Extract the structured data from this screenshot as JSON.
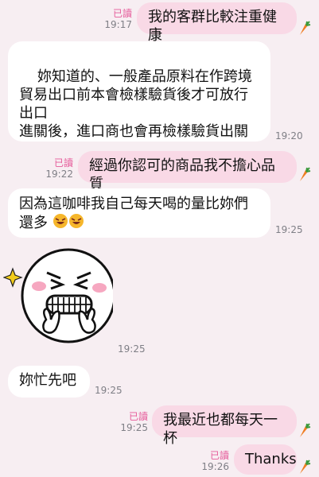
{
  "messages": {
    "m1": {
      "text": "我的客群比較注重健康",
      "read": "已讀",
      "time": "19:17"
    },
    "m2": {
      "text": "妳知道的、一般產品原料在作跨境貿易出口前本會檢樣驗貨後才可放行出口\n進關後，進口商也會再檢樣驗貨出關",
      "time": "19:20"
    },
    "m3": {
      "text": "經過你認可的商品我不擔心品質",
      "read": "已讀",
      "time": "19:22"
    },
    "m4": {
      "text": "因為這咖啡我自己每天喝的量比妳們還多",
      "time": "19:25"
    },
    "m5": {
      "time": "19:25"
    },
    "m6": {
      "text": "妳忙先吧",
      "time": "19:25"
    },
    "m7": {
      "text": "我最近也都每天一杯",
      "read": "已讀",
      "time": "19:25"
    },
    "m8": {
      "text": "Thanks",
      "read": "已讀",
      "time": "19:26"
    }
  },
  "icons": {
    "carrot": "carrot-icon",
    "sticker": "grinning-face-sticker",
    "emoji": "rofl-emoji"
  },
  "colors": {
    "background": "#f7eef2",
    "outgoing_bubble": "#f9d9e6",
    "incoming_bubble": "#ffffff",
    "read_label": "#e65b9a",
    "time": "#7f7f86"
  }
}
